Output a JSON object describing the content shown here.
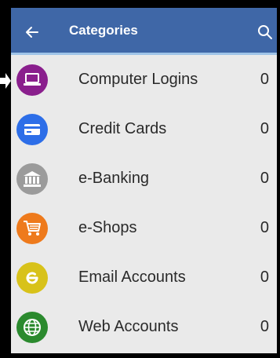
{
  "appbar": {
    "title": "Categories",
    "color": "#3f67a7",
    "back_icon": "arrow-left-icon",
    "search_icon": "search-icon"
  },
  "categories": [
    {
      "label": "Computer Logins",
      "count": "0",
      "icon": "laptop-icon",
      "color": "#8a1f8d"
    },
    {
      "label": "Credit Cards",
      "count": "0",
      "icon": "credit-card-icon",
      "color": "#2d6ee8"
    },
    {
      "label": "e-Banking",
      "count": "0",
      "icon": "bank-icon",
      "color": "#9b9b9b"
    },
    {
      "label": "e-Shops",
      "count": "0",
      "icon": "shopping-cart-icon",
      "color": "#ee7a1c"
    },
    {
      "label": "Email Accounts",
      "count": "0",
      "icon": "email-icon",
      "color": "#d8c21a"
    },
    {
      "label": "Web Accounts",
      "count": "0",
      "icon": "globe-icon",
      "color": "#2b8a2e"
    }
  ]
}
